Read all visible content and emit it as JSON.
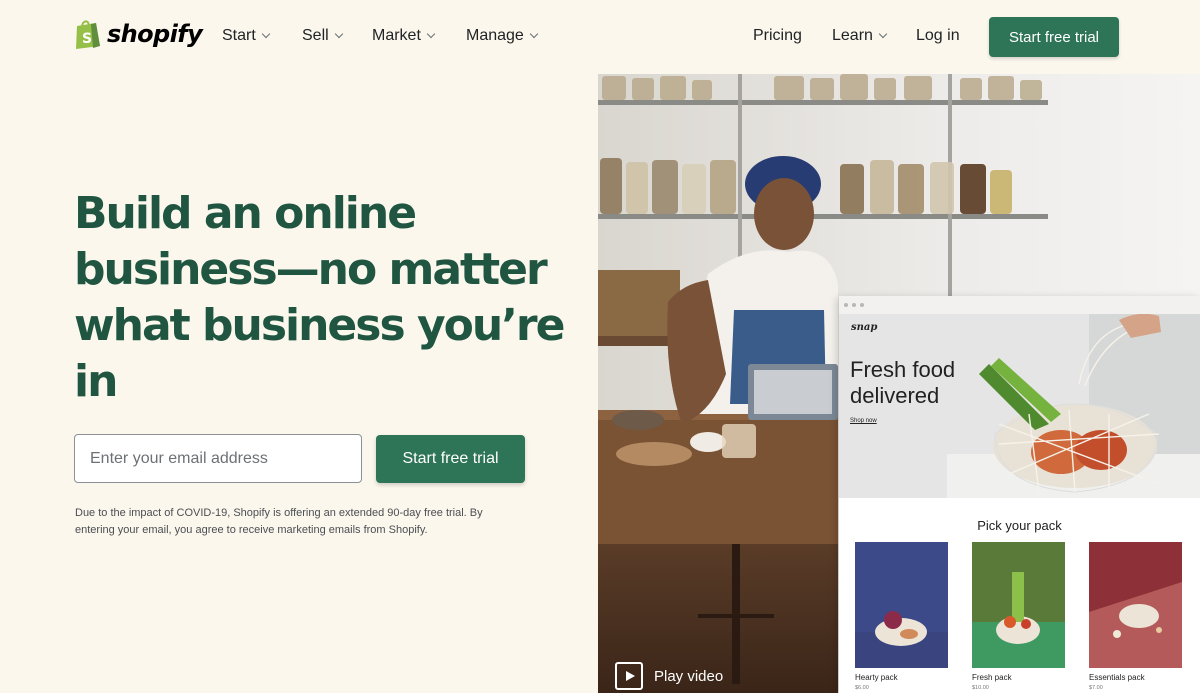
{
  "brand": {
    "name": "shopify",
    "logo_icon": "shopping-bag-icon",
    "accent": "#2e7457",
    "headline_color": "#1f5541"
  },
  "nav": {
    "menus": [
      {
        "label": "Start"
      },
      {
        "label": "Sell"
      },
      {
        "label": "Market"
      },
      {
        "label": "Manage"
      }
    ],
    "pricing": "Pricing",
    "learn": "Learn",
    "login": "Log in",
    "cta": "Start free trial"
  },
  "hero": {
    "headline": "Build an online business—no matter what business you’re in",
    "email_placeholder": "Enter your email address",
    "email_value": "",
    "cta": "Start free trial",
    "disclaimer": "Due to the impact of COVID-19, Shopify is offering an extended 90-day free trial. By entering your email, you agree to receive marketing emails from Shopify."
  },
  "store_preview": {
    "brand": "snap",
    "headline": "Fresh food delivered",
    "link": "Shop now",
    "section_title": "Pick your pack",
    "packs": [
      {
        "name": "Hearty pack",
        "price": "$6.00",
        "color": "#3d4a8a"
      },
      {
        "name": "Fresh pack",
        "price": "$10.00",
        "color": "#5a7a3a"
      },
      {
        "name": "Essentials pack",
        "price": "$7.00",
        "color": "#8e3038"
      }
    ]
  },
  "video": {
    "label": "Play video",
    "icon": "play-icon"
  }
}
